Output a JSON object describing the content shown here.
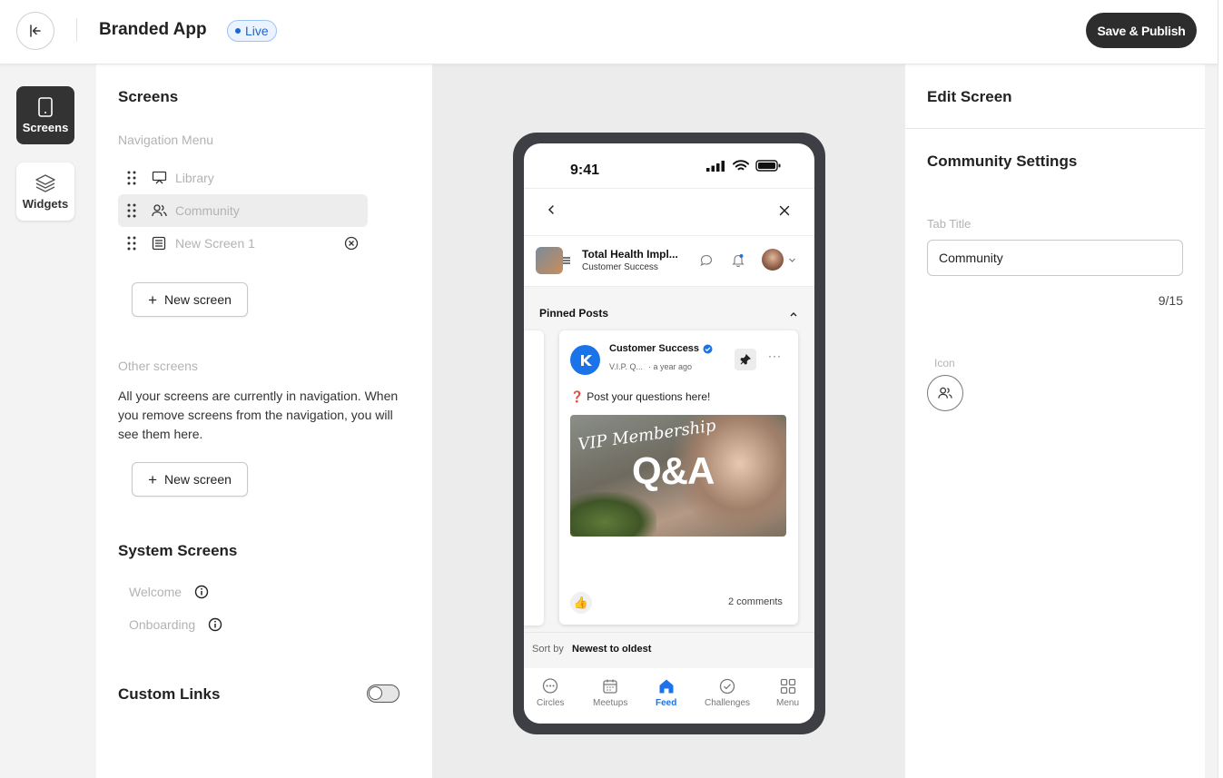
{
  "topbar": {
    "app_title": "Branded App",
    "live_label": "Live",
    "publish_label": "Save & Publish",
    "back_icon": "collapse-left-icon"
  },
  "rail": {
    "screens_label": "Screens",
    "widgets_label": "Widgets"
  },
  "screens_panel": {
    "title": "Screens",
    "nav_menu_label": "Navigation Menu",
    "nav_items": [
      {
        "label": "Library",
        "icon": "presentation-board-icon"
      },
      {
        "label": "Community",
        "icon": "users-icon"
      },
      {
        "label": "New Screen 1",
        "icon": "list-doc-icon"
      }
    ],
    "new_screen_label": "New screen",
    "other_screens_label": "Other screens",
    "other_screens_info": "All your screens are currently in navigation. When you remove screens from the navigation, you will see them here.",
    "new_screen_label_2": "New screen",
    "system_title": "System Screens",
    "system_items": [
      "Welcome",
      "Onboarding"
    ],
    "custom_links_title": "Custom Links",
    "custom_links_enabled": false
  },
  "phone": {
    "time": "9:41",
    "community_title": "Total Health Impl...",
    "community_sub": "Customer Success",
    "pinned_label": "Pinned Posts",
    "post": {
      "author": "Customer Success",
      "meta_group": "V.I.P. Q...",
      "meta_time": "· a year ago",
      "text": "❓ Post your questions here!",
      "image_caption_1": "VIP Membership",
      "image_caption_2": "Q&A",
      "reaction": "👍",
      "comments": "2 comments"
    },
    "sort_prefix": "Sort by",
    "sort_value": "Newest to oldest",
    "tabs": [
      {
        "label": "Circles",
        "icon": "chat-bubble-icon"
      },
      {
        "label": "Meetups",
        "icon": "calendar-icon"
      },
      {
        "label": "Feed",
        "icon": "home-icon",
        "active": true
      },
      {
        "label": "Challenges",
        "icon": "check-circle-icon"
      },
      {
        "label": "Menu",
        "icon": "grid-icon"
      }
    ]
  },
  "edit_panel": {
    "title": "Edit Screen",
    "section_title": "Community Settings",
    "tab_title_label": "Tab Title",
    "tab_title_value": "Community",
    "counter": "9/15",
    "icon_label": "Icon",
    "icon_name": "users-icon"
  },
  "colors": {
    "accent": "#1a73e8",
    "dark_button": "#2d2d2d",
    "live_badge": "#1a66d9"
  }
}
